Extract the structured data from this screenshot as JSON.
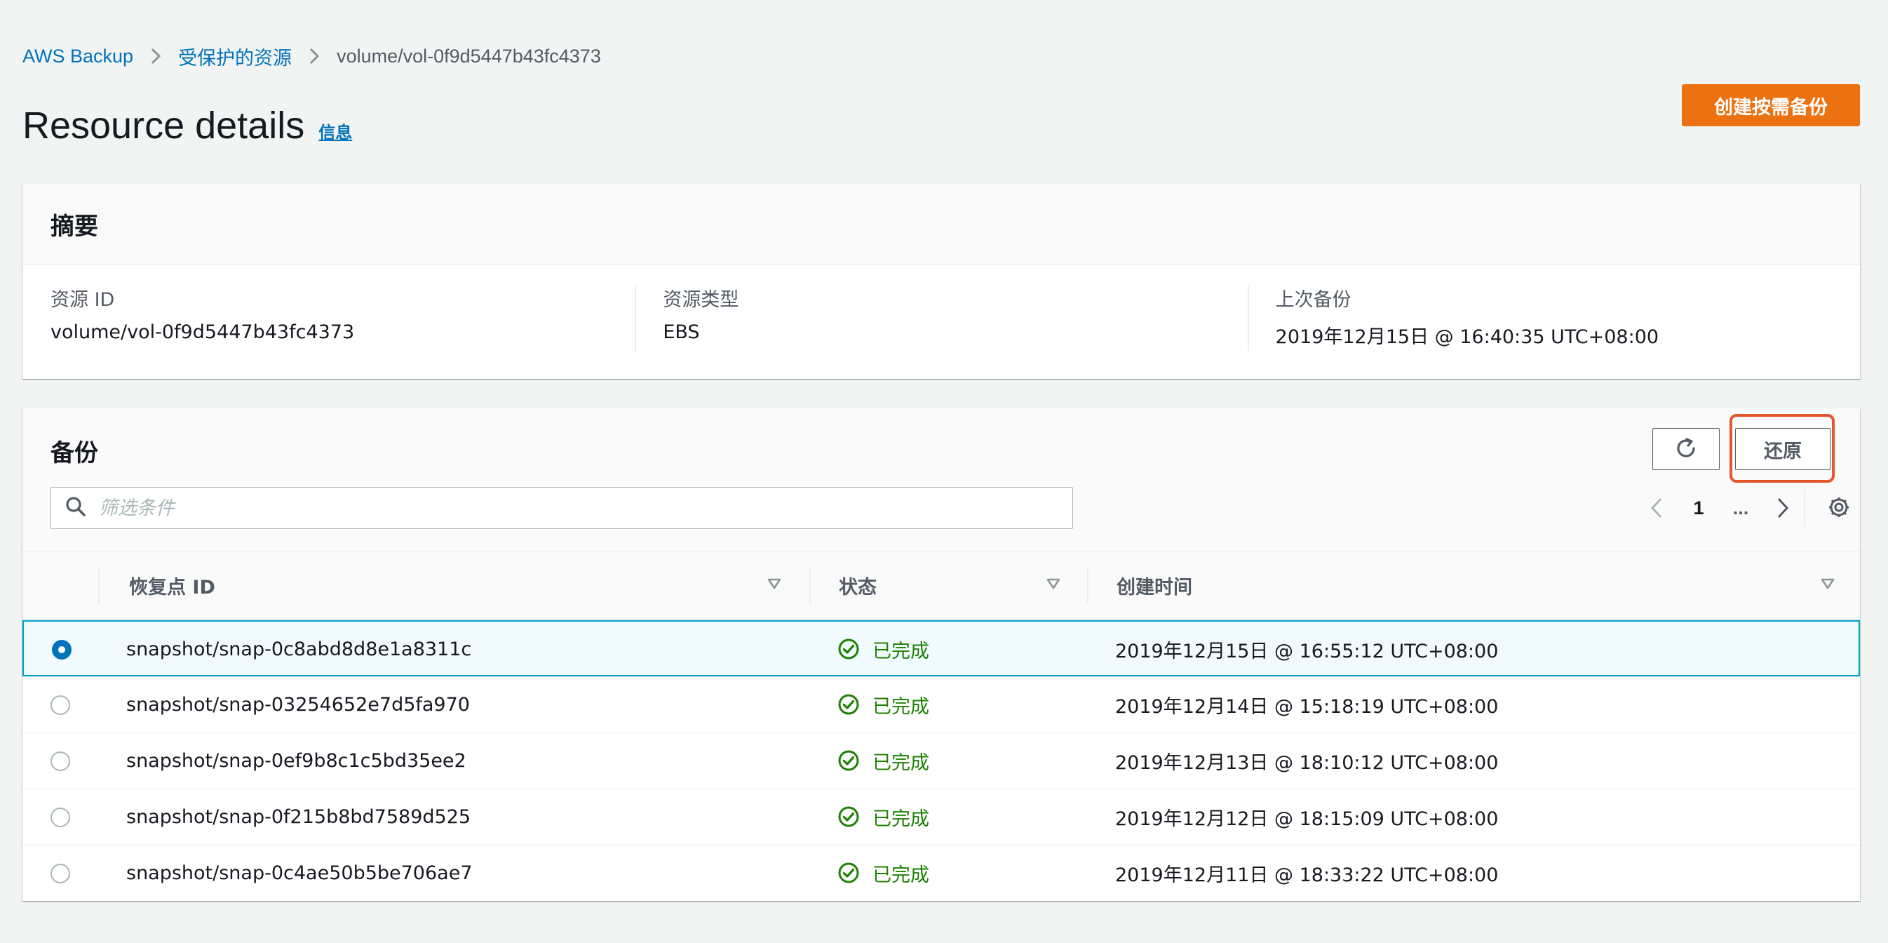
{
  "breadcrumb": {
    "items": [
      "AWS Backup",
      "受保护的资源"
    ],
    "current": "volume/vol-0f9d5447b43fc4373"
  },
  "header": {
    "title": "Resource details",
    "info_link": "信息",
    "primary_button": "创建按需备份"
  },
  "summary": {
    "title": "摘要",
    "fields": [
      {
        "label": "资源 ID",
        "value": "volume/vol-0f9d5447b43fc4373"
      },
      {
        "label": "资源类型",
        "value": "EBS"
      },
      {
        "label": "上次备份",
        "value": "2019年12月15日 @ 16:40:35 UTC+08:00"
      }
    ]
  },
  "backups": {
    "title": "备份",
    "restore_label": "还原",
    "search": {
      "placeholder": "筛选条件",
      "value": ""
    },
    "pagination": {
      "current_page": "1",
      "more": "..."
    },
    "columns": [
      "恢复点 ID",
      "状态",
      "创建时间"
    ],
    "rows": [
      {
        "id": "snapshot/snap-0c8abd8d8e1a8311c",
        "status": "已完成",
        "created": "2019年12月15日 @ 16:55:12 UTC+08:00",
        "selected": true
      },
      {
        "id": "snapshot/snap-03254652e7d5fa970",
        "status": "已完成",
        "created": "2019年12月14日 @ 15:18:19 UTC+08:00",
        "selected": false
      },
      {
        "id": "snapshot/snap-0ef9b8c1c5bd35ee2",
        "status": "已完成",
        "created": "2019年12月13日 @ 18:10:12 UTC+08:00",
        "selected": false
      },
      {
        "id": "snapshot/snap-0f215b8bd7589d525",
        "status": "已完成",
        "created": "2019年12月12日 @ 18:15:09 UTC+08:00",
        "selected": false
      },
      {
        "id": "snapshot/snap-0c4ae50b5be706ae7",
        "status": "已完成",
        "created": "2019年12月11日 @ 18:33:22 UTC+08:00",
        "selected": false
      }
    ]
  },
  "colors": {
    "link": "#0073bb",
    "primary": "#ec7211",
    "success": "#1d8102",
    "selected_border": "#00a1c9",
    "highlight": "#e4572e"
  },
  "icons": {
    "breadcrumb_separator": "chevron-right-icon",
    "refresh": "refresh-icon",
    "search": "search-icon",
    "prev": "chevron-left-icon",
    "next": "chevron-right-icon",
    "settings": "gear-icon",
    "sort": "caret-down-icon",
    "status": "check-circle-icon"
  }
}
